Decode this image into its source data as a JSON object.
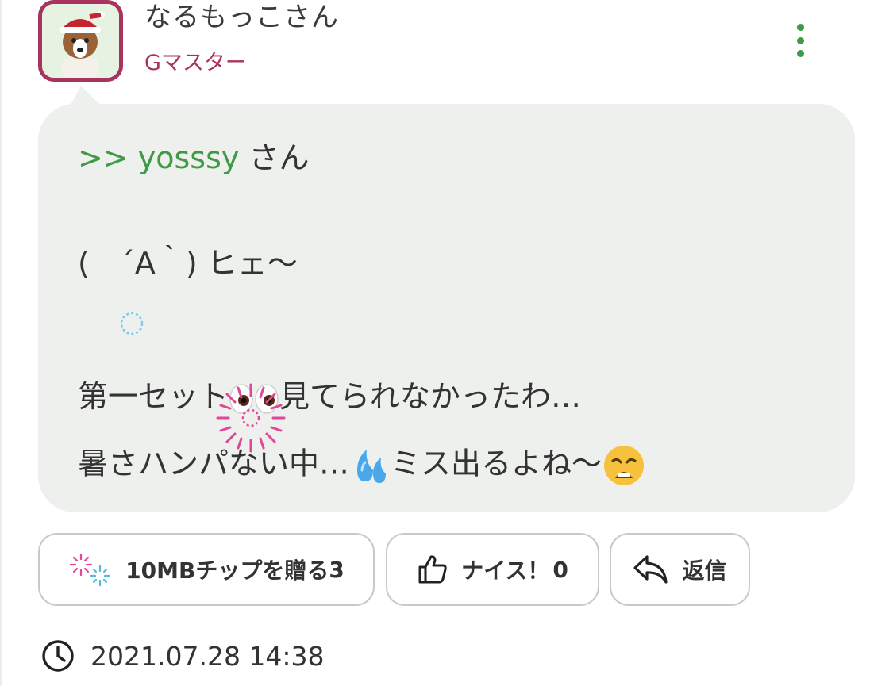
{
  "post": {
    "username": "なるもっこさん",
    "rank": "Gマスター",
    "reply_prefix": ">> yosssy",
    "reply_suffix": " さん",
    "lines": [
      "(　´A｀) ヒェ〜",
      "第一セット",
      "見てられなかったわ…",
      "暑さハンパない中…",
      "ミス出るよね〜"
    ],
    "timestamp": "2021.07.28 14:38"
  },
  "actions": {
    "chip_label": "10MBチップを贈る",
    "chip_count": "3",
    "nice_label": "ナイス！",
    "nice_count": "0",
    "reply_label": "返信"
  },
  "icons": {
    "menu": "more-vertical-icon",
    "chip": "fireworks-icon",
    "nice": "thumbs-up-icon",
    "reply": "reply-arrow-icon",
    "clock": "clock-icon",
    "emoji_eyes": "eyes-emoji",
    "emoji_sweat": "sweat-droplets-emoji",
    "emoji_weary": "weary-face-emoji"
  },
  "colors": {
    "accent_green": "#3f9a46",
    "rank_maroon": "#a8335e",
    "bubble_bg": "#edf0ec",
    "button_border": "#c9c9c9"
  }
}
